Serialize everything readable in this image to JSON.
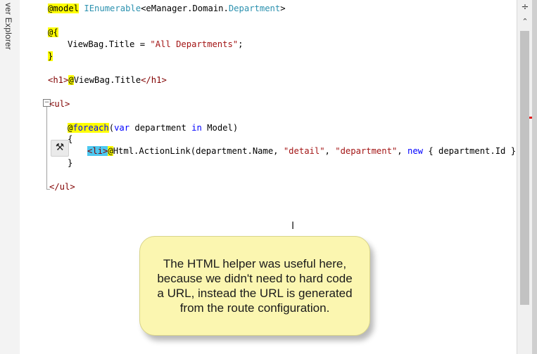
{
  "side_panel": {
    "label": "ver Explorer"
  },
  "code": {
    "line1": {
      "razor": "@model",
      "type_a": "IEnumerable",
      "plain": "<eManager.Domain.",
      "type_b": "Department",
      "close": ">"
    },
    "line2": {
      "razor": "@{"
    },
    "line3": {
      "plain": "ViewBag.Title = ",
      "str": "\"All Departments\"",
      "end": ";"
    },
    "line4": {
      "brace": "}"
    },
    "line5": {
      "tag_open": "<h1>",
      "razor": "@",
      "plain": "ViewBag.Title",
      "tag_close": "</h1>"
    },
    "line6": {
      "tag": "<ul>"
    },
    "line7": {
      "razor": "@",
      "kw_foreach": "foreach",
      "p1": "(",
      "kw_var": "var",
      "p2": " department ",
      "kw_in": "in",
      "p3": " Model)"
    },
    "line8": {
      "brace": "{"
    },
    "line9": {
      "tag_li": "<li>",
      "razor": "@",
      "call": "Html.ActionLink(department.Name, ",
      "str1": "\"detail\"",
      "sep": ", ",
      "str2": "\"department\"",
      "sep2": ", ",
      "kw_new": "new",
      "rest": " { department.Id }, nul"
    },
    "line10": {
      "brace": "}"
    },
    "line11": {
      "tag": "</ul>"
    }
  },
  "outline_markers": {
    "collapse": "−"
  },
  "icons": {
    "hammer": "hammer-icon",
    "split": "split-view-icon",
    "chevron": "chevron-down-icon"
  },
  "callout": {
    "text": "The HTML helper was useful here,\nbecause we didn't need to hard code\na URL, instead the URL is generated\nfrom the route configuration."
  },
  "colors": {
    "keyword": "#0000ff",
    "type": "#2b91af",
    "string": "#a31515",
    "tag": "#800000",
    "razor_highlight": "#ffff00",
    "callout_bg": "#fbf6b0"
  }
}
